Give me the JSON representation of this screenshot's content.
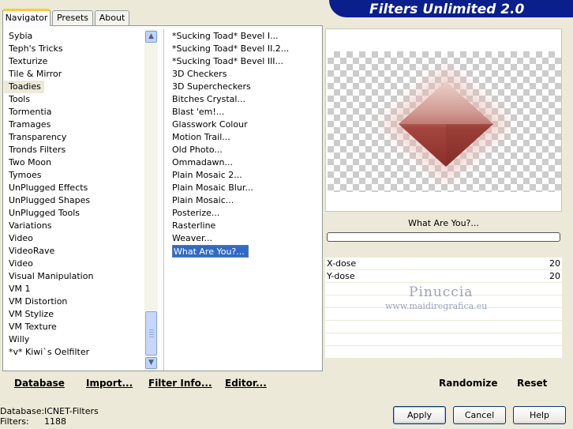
{
  "tabs": [
    {
      "label": "Navigator",
      "active": true
    },
    {
      "label": "Presets",
      "active": false
    },
    {
      "label": "About",
      "active": false
    }
  ],
  "header": {
    "title": "Filters Unlimited 2.0"
  },
  "categories": [
    {
      "label": "Sybia"
    },
    {
      "label": "Teph's Tricks"
    },
    {
      "label": "Texturize"
    },
    {
      "label": "Tile & Mirror"
    },
    {
      "label": "Toadies",
      "selected": true
    },
    {
      "label": "Tools"
    },
    {
      "label": "Tormentia"
    },
    {
      "label": "Tramages"
    },
    {
      "label": "Transparency"
    },
    {
      "label": "Tronds Filters"
    },
    {
      "label": "Two Moon"
    },
    {
      "label": "Tymoes"
    },
    {
      "label": "UnPlugged Effects"
    },
    {
      "label": "UnPlugged Shapes"
    },
    {
      "label": "UnPlugged Tools"
    },
    {
      "label": "Variations"
    },
    {
      "label": "Video"
    },
    {
      "label": "VideoRave"
    },
    {
      "label": "Video"
    },
    {
      "label": "Visual Manipulation"
    },
    {
      "label": "VM 1"
    },
    {
      "label": "VM Distortion"
    },
    {
      "label": "VM Stylize"
    },
    {
      "label": "VM Texture"
    },
    {
      "label": "Willy"
    },
    {
      "label": "*v* Kiwi`s Oelfilter"
    }
  ],
  "filters": [
    {
      "label": "*Sucking Toad*  Bevel I..."
    },
    {
      "label": "*Sucking Toad*  Bevel II.2..."
    },
    {
      "label": "*Sucking Toad*  Bevel III..."
    },
    {
      "label": "3D Checkers"
    },
    {
      "label": "3D Supercheckers"
    },
    {
      "label": "Bitches Crystal..."
    },
    {
      "label": "Blast 'em!..."
    },
    {
      "label": "Glasswork Colour"
    },
    {
      "label": "Motion Trail..."
    },
    {
      "label": "Old Photo..."
    },
    {
      "label": "Ommadawn..."
    },
    {
      "label": "Plain Mosaic 2..."
    },
    {
      "label": "Plain Mosaic Blur..."
    },
    {
      "label": "Plain Mosaic..."
    },
    {
      "label": "Posterize..."
    },
    {
      "label": "Rasterline"
    },
    {
      "label": "Weaver..."
    },
    {
      "label": "What Are You?...",
      "selected": true
    }
  ],
  "list_buttons": {
    "database": "Database",
    "import": "Import...",
    "filter_info": "Filter Info...",
    "editor": "Editor..."
  },
  "preview": {
    "filter_name": "What Are You?...",
    "progress": 0
  },
  "params": [
    {
      "name": "X-dose",
      "value": "20"
    },
    {
      "name": "Y-dose",
      "value": "20"
    }
  ],
  "preview_buttons": {
    "randomize": "Randomize",
    "reset": "Reset"
  },
  "watermark": {
    "name": "Pinuccia",
    "url": "www.maidiregrafica.eu"
  },
  "status": {
    "database_label": "Database:",
    "database_value": "ICNET-Filters",
    "filters_label": "Filters:",
    "filters_value": "1188"
  },
  "dialog_buttons": {
    "apply": "Apply",
    "cancel": "Cancel",
    "help": "Help"
  },
  "colors": {
    "header_bg": "#0A1E8C",
    "selection_blue": "#316AC5",
    "window_bg": "#ECE9D8",
    "diamond": "#A0443F"
  }
}
